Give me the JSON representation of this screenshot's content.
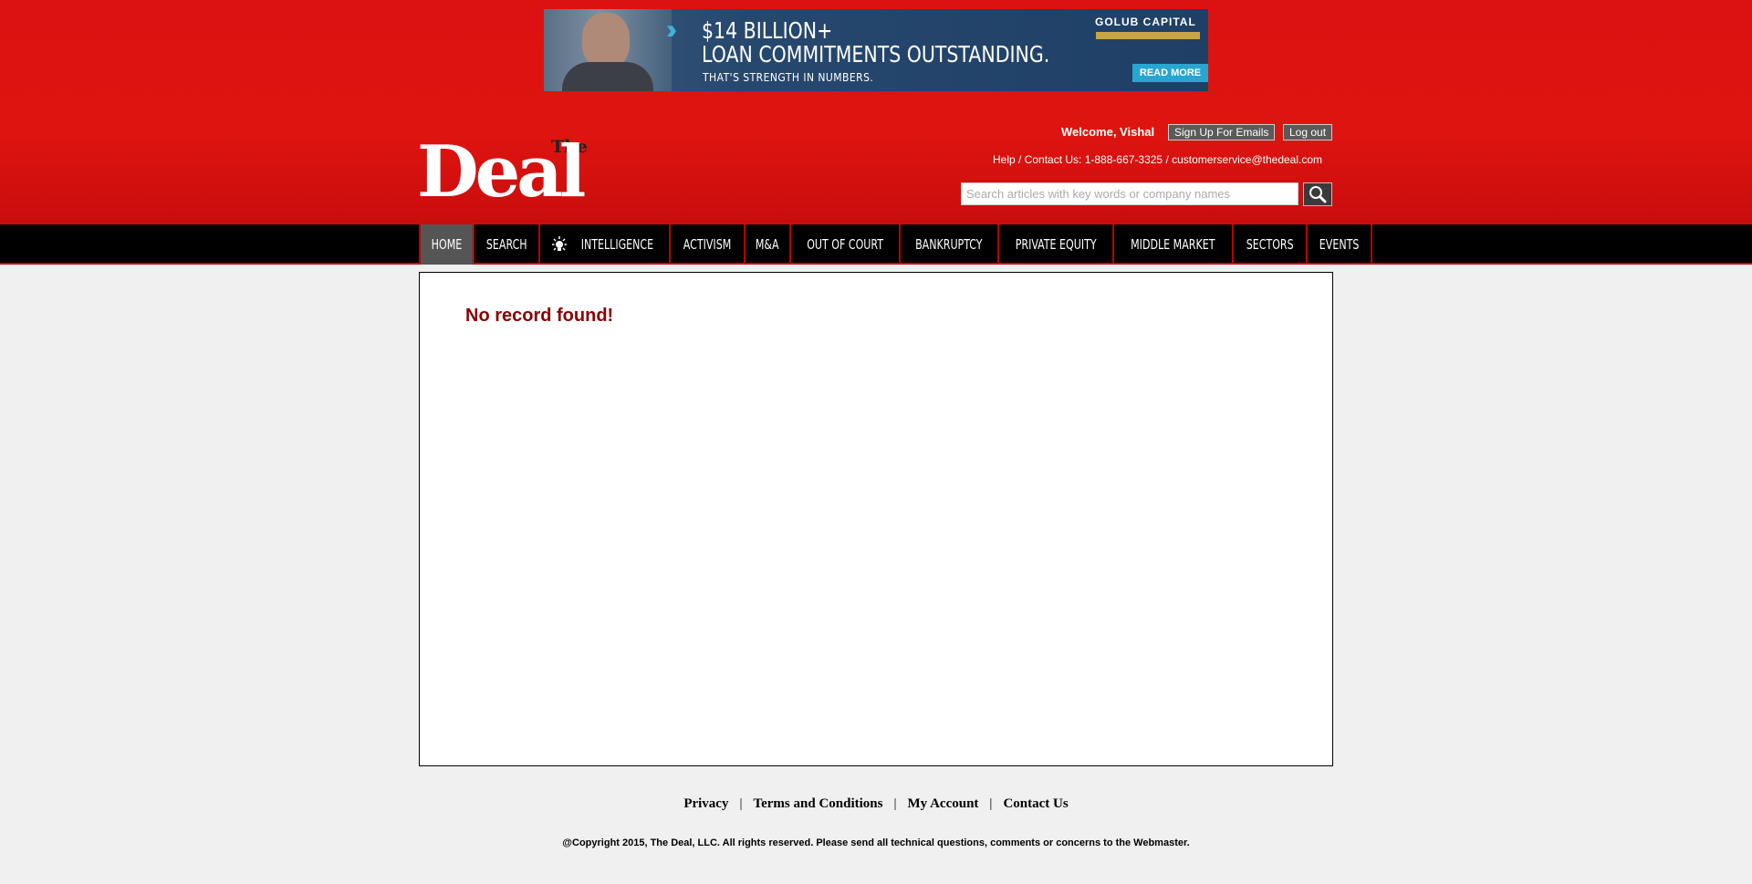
{
  "banner": {
    "headline1": "$14 BILLION+",
    "headline2": "LOAN COMMITMENTS OUTSTANDING.",
    "tagline": "THAT'S STRENGTH IN NUMBERS.",
    "brand": "GOLUB CAPITAL",
    "cta": "READ MORE"
  },
  "header": {
    "logo_the": "The",
    "logo_deal": "Deal",
    "welcome": "Welcome, Vishal",
    "signup_label": "Sign Up For Emails",
    "logout_label": "Log out",
    "help_text": "Help / Contact Us: 1-888-667-3325 / customerservice@thedeal.com",
    "search_placeholder": "Search articles with key words or company names"
  },
  "nav": {
    "items": [
      {
        "label": "HOME"
      },
      {
        "label": "SEARCH"
      },
      {
        "label": "INTELLIGENCE"
      },
      {
        "label": "ACTIVISM"
      },
      {
        "label": "M&A"
      },
      {
        "label": "OUT OF COURT"
      },
      {
        "label": "BANKRUPTCY"
      },
      {
        "label": "PRIVATE EQUITY"
      },
      {
        "label": "MIDDLE MARKET"
      },
      {
        "label": "SECTORS"
      },
      {
        "label": "EVENTS"
      }
    ]
  },
  "main": {
    "message": "No record found!"
  },
  "footer": {
    "links": [
      "Privacy",
      "Terms and Conditions",
      "My Account",
      "Contact Us"
    ],
    "separator": "|",
    "copyright": "@Copyright 2015, The Deal, LLC. All rights reserved. Please send all technical questions, comments or concerns to the Webmaster."
  },
  "colors": {
    "header_red": "#dc1212",
    "nav_black": "#000000",
    "message_red": "#8b0000",
    "banner_blue": "#27486e",
    "banner_accent": "#26a6d1",
    "banner_gold": "#c9a544"
  },
  "icons": {
    "search": "magnifier-icon",
    "intelligence": "lightbulb-icon",
    "banner_arrow": "double-chevron-icon"
  }
}
